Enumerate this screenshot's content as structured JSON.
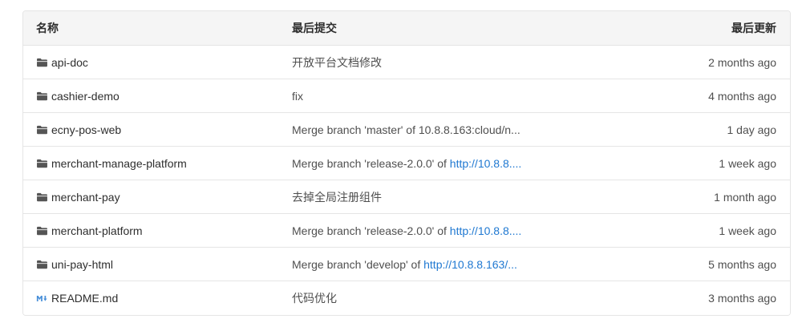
{
  "header": {
    "name": "名称",
    "last_commit": "最后提交",
    "last_update": "最后更新"
  },
  "rows": [
    {
      "name": "api-doc",
      "icon": "folder-icon",
      "commit": "开放平台文档修改",
      "commit_url": "",
      "date": "2 months ago"
    },
    {
      "name": "cashier-demo",
      "icon": "folder-icon",
      "commit": "fix",
      "commit_url": "",
      "date": "4 months ago"
    },
    {
      "name": "ecny-pos-web",
      "icon": "folder-icon",
      "commit": "Merge branch 'master' of 10.8.8.163:cloud/n...",
      "commit_url": "",
      "date": "1 day ago"
    },
    {
      "name": "merchant-manage-platform",
      "icon": "folder-icon",
      "commit": "Merge branch 'release-2.0.0' of ",
      "commit_url": "http://10.8.8....",
      "date": "1 week ago"
    },
    {
      "name": "merchant-pay",
      "icon": "folder-icon",
      "commit": "去掉全局注册组件",
      "commit_url": "",
      "date": "1 month ago"
    },
    {
      "name": "merchant-platform",
      "icon": "folder-icon",
      "commit": "Merge branch 'release-2.0.0' of ",
      "commit_url": "http://10.8.8....",
      "date": "1 week ago"
    },
    {
      "name": "uni-pay-html",
      "icon": "folder-icon",
      "commit": "Merge branch 'develop' of ",
      "commit_url": "http://10.8.8.163/...",
      "date": "5 months ago"
    },
    {
      "name": "README.md",
      "icon": "markdown-icon",
      "commit": "代码优化",
      "commit_url": "",
      "date": "3 months ago"
    }
  ],
  "colors": {
    "link_blue": "#1f78d1",
    "header_bg": "#f5f5f5",
    "border": "#e5e5e5"
  }
}
